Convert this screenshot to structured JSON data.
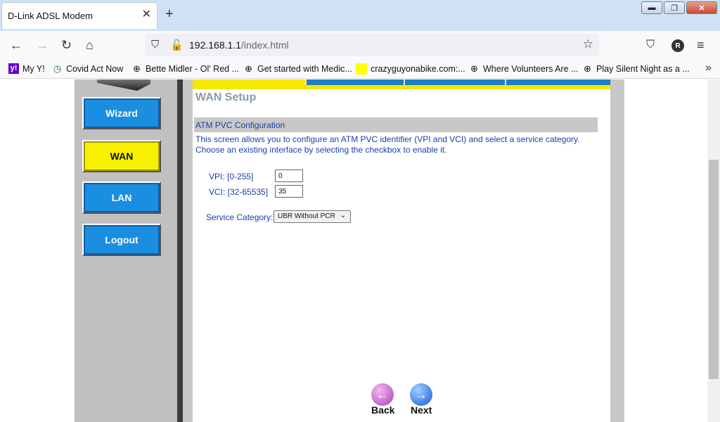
{
  "browser": {
    "tab_title": "D-Link ADSL Modem",
    "tab_close": "✕",
    "new_tab": "+",
    "url_host": "192.168.1.1",
    "url_path": "/index.html",
    "account_initial": "R",
    "window_buttons": {
      "minimize": "▬",
      "maximize": "❐",
      "close": "✕"
    }
  },
  "bookmarks": [
    {
      "label": "My Y!",
      "icon": "yahoo-icon"
    },
    {
      "label": "Covid Act Now",
      "icon": "covid-act-now-icon"
    },
    {
      "label": "Bette Midler - Ol' Red ...",
      "icon": "globe-icon"
    },
    {
      "label": "Get started with Medic...",
      "icon": "globe-icon"
    },
    {
      "label": "crazyguyonabike.com:...",
      "icon": "yellow-square-icon"
    },
    {
      "label": "Where Volunteers Are ...",
      "icon": "globe-icon"
    },
    {
      "label": "Play Silent Night as a ...",
      "icon": "globe-icon"
    }
  ],
  "sidebar": {
    "items": [
      {
        "label": "Wizard",
        "color": "#1a8ee0"
      },
      {
        "label": "WAN",
        "color": "#f7f000"
      },
      {
        "label": "LAN",
        "color": "#1a8ee0"
      },
      {
        "label": "Logout",
        "color": "#1a8ee0"
      }
    ]
  },
  "main": {
    "page_title": "WAN Setup",
    "section_title": "ATM PVC Configuration",
    "description": "This screen allows you to configure an ATM PVC identifier (VPI and VCI) and select a service category. Choose an existing interface by selecting the checkbox to enable it.",
    "vpi_label": "VPI: [0-255]",
    "vpi_value": "0",
    "vci_label": "VCI: [32-65535]",
    "vci_value": "35",
    "service_label": "Service Category:",
    "service_value": "UBR Without PCR",
    "back_label": "Back",
    "next_label": "Next"
  },
  "colors": {
    "accent_blue": "#1a8ee0",
    "accent_yellow": "#f7f000",
    "link_text": "#1a40a8"
  }
}
